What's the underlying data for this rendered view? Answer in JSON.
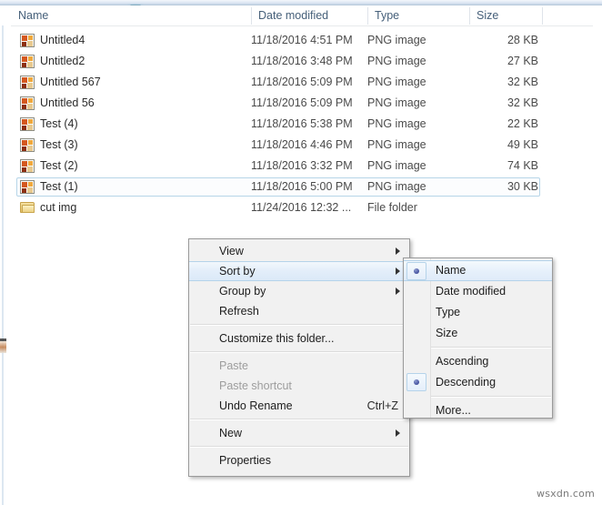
{
  "window": {
    "type": "file-explorer-list"
  },
  "columns": [
    {
      "key": "name",
      "label": "Name",
      "sorted": true,
      "sort_direction": "descending"
    },
    {
      "key": "date",
      "label": "Date modified"
    },
    {
      "key": "type",
      "label": "Type"
    },
    {
      "key": "size",
      "label": "Size"
    }
  ],
  "files": [
    {
      "icon": "png-image-icon",
      "name": "Untitled4",
      "date": "11/18/2016 4:51 PM",
      "type": "PNG image",
      "size": "28 KB",
      "focused": false
    },
    {
      "icon": "png-image-icon",
      "name": "Untitled2",
      "date": "11/18/2016 3:48 PM",
      "type": "PNG image",
      "size": "27 KB",
      "focused": false
    },
    {
      "icon": "png-image-icon",
      "name": "Untitled 567",
      "date": "11/18/2016 5:09 PM",
      "type": "PNG image",
      "size": "32 KB",
      "focused": false
    },
    {
      "icon": "png-image-icon",
      "name": "Untitled 56",
      "date": "11/18/2016 5:09 PM",
      "type": "PNG image",
      "size": "32 KB",
      "focused": false
    },
    {
      "icon": "png-image-icon",
      "name": "Test (4)",
      "date": "11/18/2016 5:38 PM",
      "type": "PNG image",
      "size": "22 KB",
      "focused": false
    },
    {
      "icon": "png-image-icon",
      "name": "Test (3)",
      "date": "11/18/2016 4:46 PM",
      "type": "PNG image",
      "size": "49 KB",
      "focused": false
    },
    {
      "icon": "png-image-icon",
      "name": "Test (2)",
      "date": "11/18/2016 3:32 PM",
      "type": "PNG image",
      "size": "74 KB",
      "focused": false
    },
    {
      "icon": "png-image-icon",
      "name": "Test (1)",
      "date": "11/18/2016 5:00 PM",
      "type": "PNG image",
      "size": "30 KB",
      "focused": true
    },
    {
      "icon": "folder-icon",
      "name": "cut img",
      "date": "11/24/2016 12:32 ...",
      "type": "File folder",
      "size": "",
      "focused": false
    }
  ],
  "context_menu": {
    "items": [
      {
        "label": "View",
        "submenu": true,
        "disabled": false,
        "highlighted": false,
        "accel": ""
      },
      {
        "label": "Sort by",
        "submenu": true,
        "disabled": false,
        "highlighted": true,
        "accel": ""
      },
      {
        "label": "Group by",
        "submenu": true,
        "disabled": false,
        "highlighted": false,
        "accel": ""
      },
      {
        "label": "Refresh",
        "submenu": false,
        "disabled": false,
        "highlighted": false,
        "accel": ""
      },
      {
        "separator": true
      },
      {
        "label": "Customize this folder...",
        "submenu": false,
        "disabled": false,
        "highlighted": false,
        "accel": ""
      },
      {
        "separator": true
      },
      {
        "label": "Paste",
        "submenu": false,
        "disabled": true,
        "highlighted": false,
        "accel": ""
      },
      {
        "label": "Paste shortcut",
        "submenu": false,
        "disabled": true,
        "highlighted": false,
        "accel": ""
      },
      {
        "label": "Undo Rename",
        "submenu": false,
        "disabled": false,
        "highlighted": false,
        "accel": "Ctrl+Z"
      },
      {
        "separator": true
      },
      {
        "label": "New",
        "submenu": true,
        "disabled": false,
        "highlighted": false,
        "accel": ""
      },
      {
        "separator": true
      },
      {
        "label": "Properties",
        "submenu": false,
        "disabled": false,
        "highlighted": false,
        "accel": ""
      }
    ]
  },
  "sort_submenu": {
    "items": [
      {
        "label": "Name",
        "checked": true,
        "highlighted": true
      },
      {
        "label": "Date modified",
        "checked": false,
        "highlighted": false
      },
      {
        "label": "Type",
        "checked": false,
        "highlighted": false
      },
      {
        "label": "Size",
        "checked": false,
        "highlighted": false
      },
      {
        "separator": true
      },
      {
        "label": "Ascending",
        "checked": false,
        "highlighted": false
      },
      {
        "label": "Descending",
        "checked": true,
        "highlighted": false
      },
      {
        "separator": true
      },
      {
        "label": "More...",
        "checked": false,
        "highlighted": false
      }
    ]
  },
  "watermark": {
    "text": "wsxdn.com"
  },
  "colors": {
    "highlight_border": "#b5d3ea",
    "header_text": "#46607a",
    "menu_bg": "#f1f1f1",
    "radio_dot": "#4c59a5"
  }
}
